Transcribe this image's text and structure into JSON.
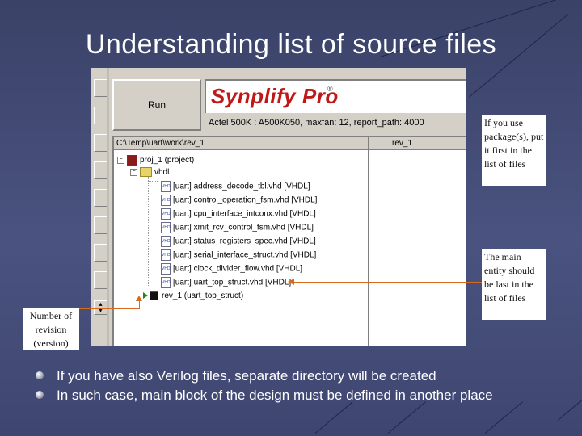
{
  "slide": {
    "title": "Understanding list of  source files",
    "bullets": [
      "If you have also Verilog files, separate directory will be created",
      "In such case, main block of the design must be defined in another place"
    ]
  },
  "screenshot": {
    "run_label": "Run",
    "logo": "Synplify Pro",
    "logo_mark": "®",
    "device_info": "Actel 500K : A500K050,  maxfan: 12,  report_path: 4000",
    "path": "C:\\Temp\\uart\\work\\rev_1",
    "rev_header": "rev_1",
    "tree": {
      "project": "proj_1 (project)",
      "folder": "vhdl",
      "files": [
        "[uart] address_decode_tbl.vhd [VHDL]",
        "[uart] control_operation_fsm.vhd [VHDL]",
        "[uart] cpu_interface_intconx.vhd [VHDL]",
        "[uart] xmit_rcv_control_fsm.vhd [VHDL]",
        "[uart] status_registers_spec.vhd [VHDL]",
        "[uart] serial_interface_struct.vhd [VHDL]",
        "[uart] clock_divider_flow.vhd [VHDL]",
        "[uart] uart_top_struct.vhd [VHDL]"
      ],
      "revision": "rev_1   (uart_top_struct)"
    }
  },
  "callouts": {
    "package": "If you use package(s), put it first in the list of  files",
    "main_entity": "The main entity should be last in the  list of files",
    "revision": "Number of revision (version)"
  },
  "colors": {
    "background": "#4a5380",
    "logo_red": "#c01818",
    "arrow": "#d86a1e"
  }
}
